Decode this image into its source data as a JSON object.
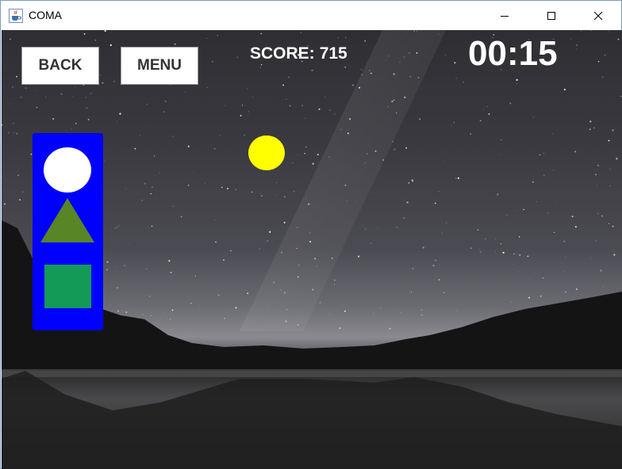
{
  "window": {
    "title": "COMA",
    "icons": {
      "app": "java-cup-icon",
      "minimize": "minimize-icon",
      "maximize": "maximize-icon",
      "close": "close-icon"
    }
  },
  "game": {
    "back_label": "BACK",
    "menu_label": "MENU",
    "score_label": "SCORE:",
    "score_value": "715",
    "timer": "00:15",
    "ball_color": "#ffff00",
    "palette": {
      "background": "#0000ff",
      "shapes": [
        {
          "name": "circle",
          "color": "#ffffff"
        },
        {
          "name": "triangle",
          "color": "#588526"
        },
        {
          "name": "square",
          "color": "#139a57"
        }
      ]
    }
  }
}
